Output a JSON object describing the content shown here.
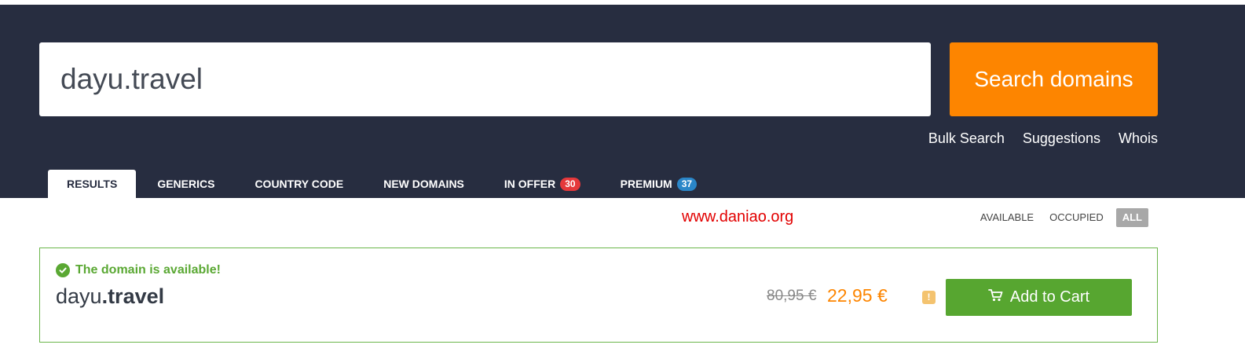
{
  "search": {
    "query": "dayu.travel",
    "button_label": "Search domains"
  },
  "sub_links": [
    "Bulk Search",
    "Suggestions",
    "Whois"
  ],
  "tabs": [
    {
      "label": "RESULTS",
      "active": true
    },
    {
      "label": "GENERICS"
    },
    {
      "label": "COUNTRY CODE"
    },
    {
      "label": "NEW DOMAINS"
    },
    {
      "label": "IN OFFER",
      "badge": "30",
      "badge_color": "#e5383b"
    },
    {
      "label": "PREMIUM",
      "badge": "37",
      "badge_color": "#2a86c8"
    }
  ],
  "watermark": "www.daniao.org",
  "filters": [
    {
      "label": "AVAILABLE"
    },
    {
      "label": "OCCUPIED"
    },
    {
      "label": "ALL",
      "active": true
    }
  ],
  "result": {
    "status": "The domain is available!",
    "domain_base": "dayu",
    "domain_ext": ".travel",
    "price_old": "80,95 €",
    "price_new": "22,95 €",
    "cart_label": "Add to Cart"
  },
  "icons": {
    "status": "check-circle-icon",
    "warning": "exclamation-icon",
    "cart": "cart-icon"
  },
  "colors": {
    "header_bg": "#272d40",
    "accent_orange": "#fd8500",
    "success_green": "#57a630",
    "watermark_red": "#e20000"
  }
}
